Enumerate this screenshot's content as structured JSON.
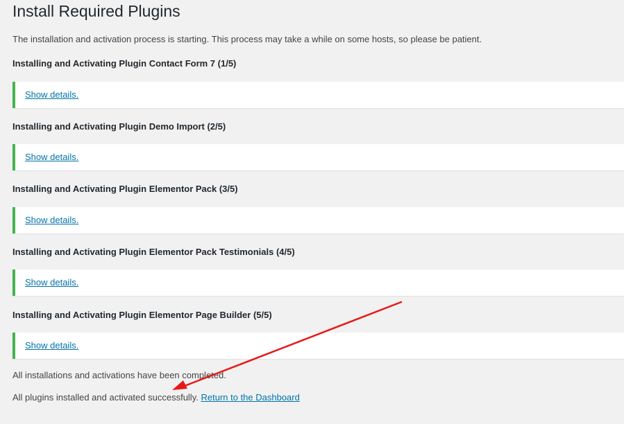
{
  "page": {
    "title": "Install Required Plugins",
    "intro": "The installation and activation process is starting. This process may take a while on some hosts, so please be patient."
  },
  "steps": [
    {
      "heading": "Installing and Activating Plugin Contact Form 7 (1/5)",
      "link": "Show details."
    },
    {
      "heading": "Installing and Activating Plugin Demo Import (2/5)",
      "link": "Show details."
    },
    {
      "heading": "Installing and Activating Plugin Elementor Pack (3/5)",
      "link": "Show details."
    },
    {
      "heading": "Installing and Activating Plugin Elementor Pack Testimonials (4/5)",
      "link": "Show details."
    },
    {
      "heading": "Installing and Activating Plugin Elementor Page Builder (5/5)",
      "link": "Show details."
    }
  ],
  "footer": {
    "completed": "All installations and activations have been completed.",
    "success": "All plugins installed and activated successfully.",
    "dashboard_link": "Return to the Dashboard"
  },
  "colors": {
    "success_border": "#46b450",
    "link": "#0073aa",
    "annotation_arrow": "#e61919"
  },
  "annotation": {
    "icon": "red-arrow-icon"
  }
}
